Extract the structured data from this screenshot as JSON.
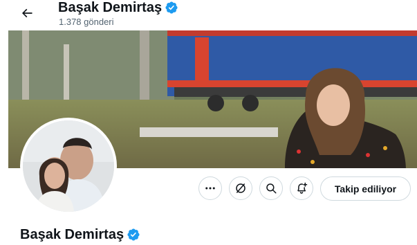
{
  "header": {
    "display_name": "Başak Demirtaş",
    "post_count": "1.378 gönderi",
    "back_icon": "arrow-left-icon",
    "verified_icon": "verified-badge-icon"
  },
  "profile": {
    "display_name": "Başak Demirtaş",
    "follow_state_label": "Takip ediliyor"
  },
  "actions": [
    {
      "icon": "more-dots-icon"
    },
    {
      "icon": "grok-icon"
    },
    {
      "icon": "search-icon"
    },
    {
      "icon": "notification-bell-plus-icon"
    }
  ],
  "colors": {
    "verified": "#1d9bf0",
    "text": "#0f1419",
    "secondary_text": "#536471",
    "border": "#cfd9de"
  }
}
